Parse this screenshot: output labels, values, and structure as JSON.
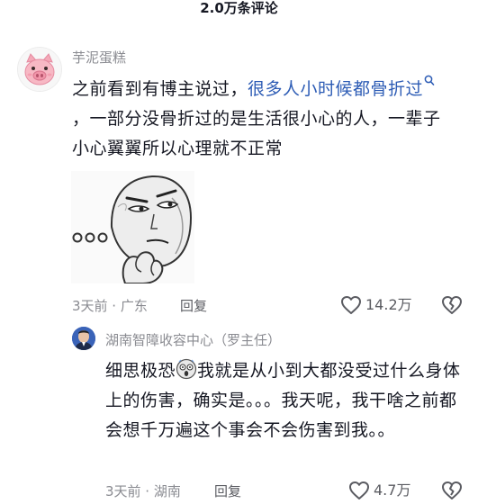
{
  "header": {
    "title": "2.0万条评论"
  },
  "comment": {
    "username": "芋泥蛋糕",
    "text_before_link": "之前看到有博主说过，",
    "link_text": "很多人小时候都骨折过",
    "text_after_link": "，一部分没骨折过的是生活很小心的人，一辈子小心翼翼所以心理就不正常",
    "meta": "3天前 · 广东",
    "reply_label": "回复",
    "like_count": "14.2万",
    "icons": [
      "pig-avatar",
      "search-icon",
      "meme-sticker",
      "heart-icon",
      "broken-heart-icon"
    ]
  },
  "reply": {
    "username": "湖南智障收容中心（罗主任）",
    "text_before_emoji": "细思极恐",
    "text_after_emoji": "我就是从小到大都没受过什么身体上的伤害，确实是。。。我天呢，我干啥之前都会想千万遍这个事会不会伤害到我。。",
    "meta": "3天前 · 湖南",
    "reply_label": "回复",
    "like_count": "4.7万",
    "icons": [
      "avatar",
      "shocked-emoji",
      "heart-icon",
      "broken-heart-icon"
    ]
  },
  "colors": {
    "text": "#161823",
    "secondary": "#8a8b91",
    "link": "#2d5cb5"
  }
}
